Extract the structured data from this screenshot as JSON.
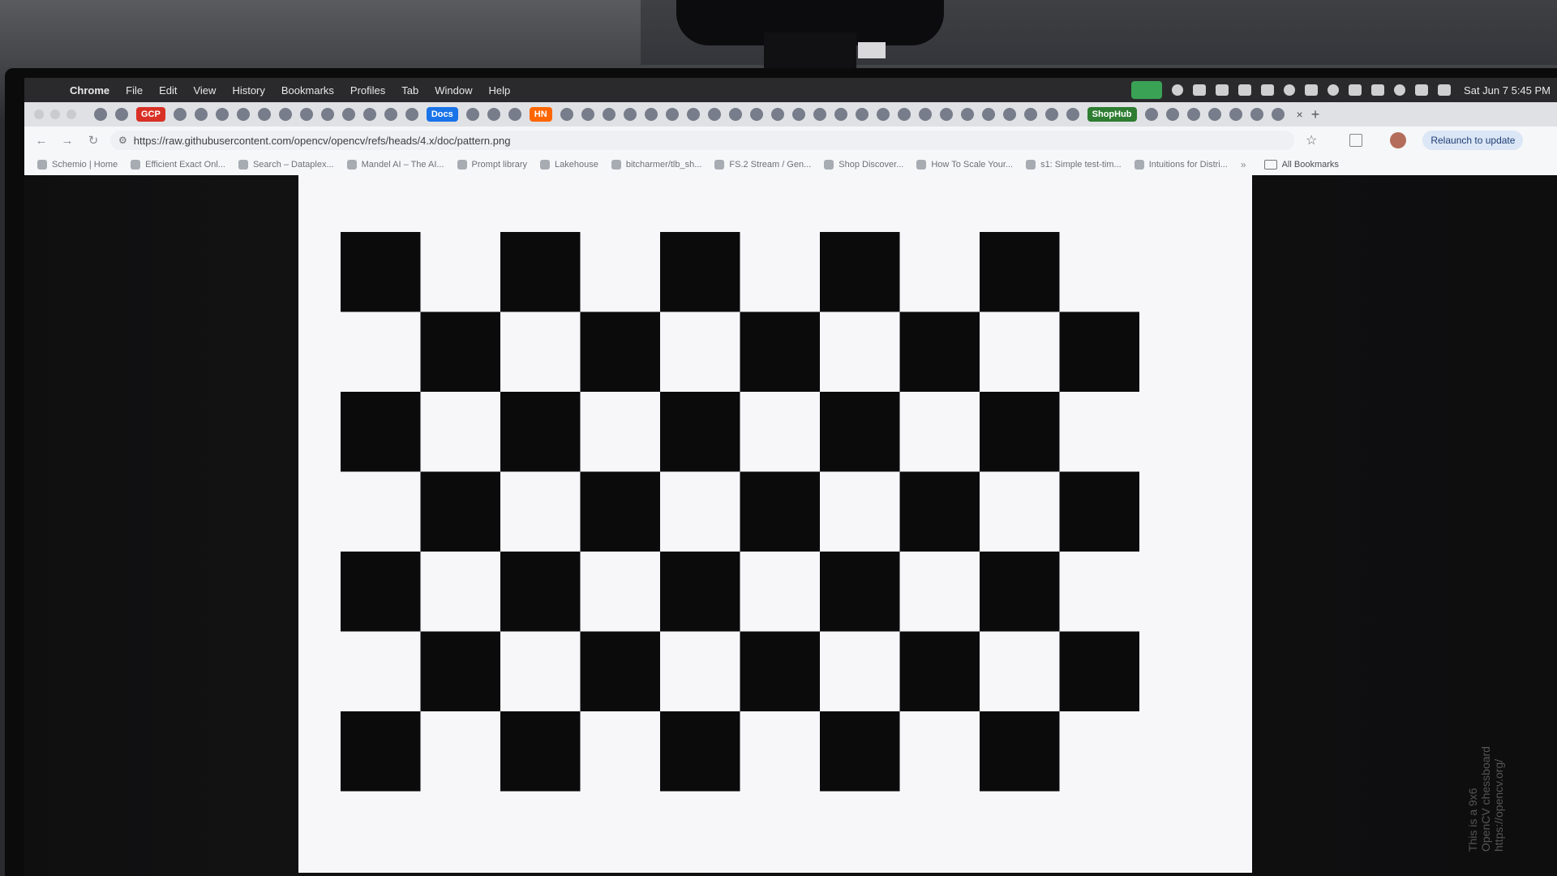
{
  "menubar": {
    "app_name": "Chrome",
    "items": [
      "File",
      "Edit",
      "View",
      "History",
      "Bookmarks",
      "Profiles",
      "Tab",
      "Window",
      "Help"
    ],
    "clock": "Sat Jun 7  5:45 PM"
  },
  "tabstrip": {
    "badges": [
      {
        "label": "GCP",
        "color": "#d93025"
      },
      {
        "label": "Docs",
        "color": "#1a73e8"
      },
      {
        "label": "HN",
        "color": "#ff6600"
      },
      {
        "label": "ShopHub",
        "color": "#2e7d32"
      }
    ],
    "new_tab": "+",
    "close": "×"
  },
  "toolbar": {
    "url": "https://raw.githubusercontent.com/opencv/opencv/refs/heads/4.x/doc/pattern.png",
    "relaunch_label": "Relaunch to update"
  },
  "bookmarks": {
    "items": [
      "Schemio | Home",
      "Efficient Exact Onl...",
      "Search – Dataplex...",
      "Mandel AI – The AI...",
      "Prompt library",
      "Lakehouse",
      "bitcharmer/tlb_sh...",
      "FS.2 Stream / Gen...",
      "Shop Discover...",
      "How To Scale Your...",
      "s1: Simple test-tim...",
      "Intuitions for Distri..."
    ],
    "more": "»",
    "all_bookmarks": "All Bookmarks"
  },
  "page": {
    "chessboard": {
      "cols": 10,
      "rows": 7,
      "dark_color": "#0b0b0b",
      "light_color": "#f7f6f9"
    },
    "caption_lines": [
      "This is a 9x6",
      "OpenCV chessboard",
      "https://opencv.org/"
    ]
  }
}
